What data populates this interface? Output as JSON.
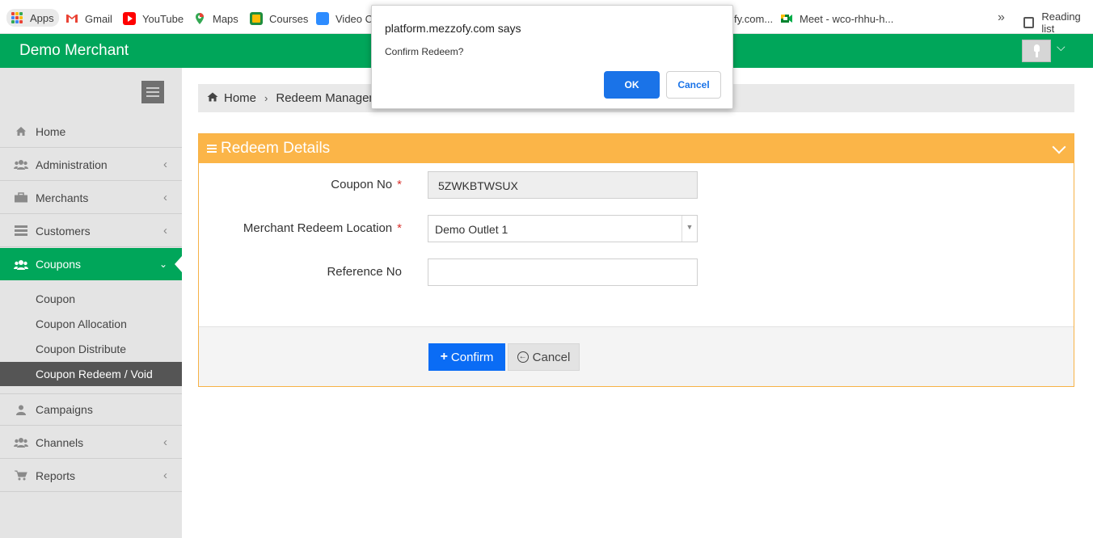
{
  "browser": {
    "bookmarks": [
      {
        "label": "Apps",
        "icon": "apps-grid-icon"
      },
      {
        "label": "Gmail",
        "icon": "gmail-icon"
      },
      {
        "label": "YouTube",
        "icon": "youtube-icon"
      },
      {
        "label": "Maps",
        "icon": "maps-icon"
      },
      {
        "label": "Courses",
        "icon": "courses-icon"
      },
      {
        "label": "Video Co",
        "icon": "video-icon"
      },
      {
        "label": "fy.com...",
        "icon": ""
      },
      {
        "label": "Meet - wco-rhhu-h...",
        "icon": "meet-icon"
      }
    ],
    "more_bookmarks": "»",
    "reading_list": "Reading list"
  },
  "header": {
    "brand": "Demo Merchant",
    "color": "#00a65a"
  },
  "sidebar": {
    "items": [
      {
        "label": "Home",
        "icon": "home-icon",
        "has_arrow": false
      },
      {
        "label": "Administration",
        "icon": "users-icon",
        "has_arrow": true
      },
      {
        "label": "Merchants",
        "icon": "briefcase-icon",
        "has_arrow": true
      },
      {
        "label": "Customers",
        "icon": "list-icon",
        "has_arrow": true
      },
      {
        "label": "Coupons",
        "icon": "users-icon",
        "has_arrow": true,
        "active": true
      },
      {
        "label": "Campaigns",
        "icon": "user-icon",
        "has_arrow": false
      },
      {
        "label": "Channels",
        "icon": "users-icon",
        "has_arrow": true
      },
      {
        "label": "Reports",
        "icon": "cart-icon",
        "has_arrow": true
      }
    ],
    "submenu": [
      {
        "label": "Coupon"
      },
      {
        "label": "Coupon Allocation"
      },
      {
        "label": "Coupon Distribute"
      },
      {
        "label": "Coupon Redeem / Void",
        "current": true
      }
    ]
  },
  "breadcrumb": {
    "home": "Home",
    "current": "Redeem Managem"
  },
  "panel": {
    "title": "Redeem Details",
    "fields": {
      "coupon_no_label": "Coupon No",
      "coupon_no_value": "5ZWKBTWSUX",
      "location_label": "Merchant Redeem Location",
      "location_value": "Demo Outlet 1",
      "reference_label": "Reference No",
      "reference_value": ""
    },
    "required_mark": "*",
    "confirm_label": "Confirm",
    "cancel_label": "Cancel",
    "accent_color": "#fbb548"
  },
  "dialog": {
    "title": "platform.mezzofy.com says",
    "message": "Confirm Redeem?",
    "ok_label": "OK",
    "cancel_label": "Cancel"
  }
}
